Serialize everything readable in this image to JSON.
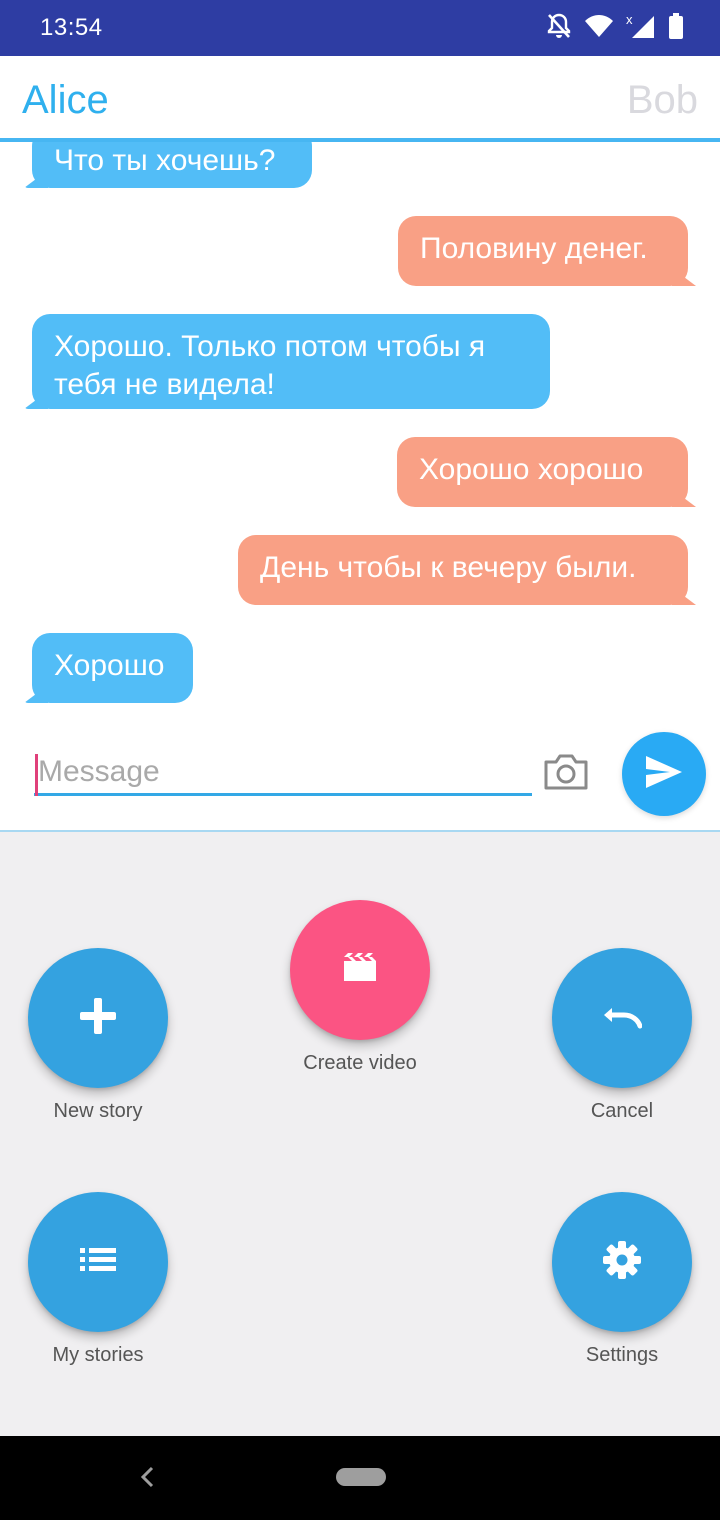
{
  "status_bar": {
    "time": "13:54",
    "icons": [
      "notifications-off-icon",
      "wifi-icon",
      "signal-icon",
      "battery-icon"
    ]
  },
  "header": {
    "left_name": "Alice",
    "right_name": "Bob"
  },
  "messages": [
    {
      "side": "left",
      "text": "Что ты хочешь?"
    },
    {
      "side": "right",
      "text": "Половину денег."
    },
    {
      "side": "left",
      "text": "Хорошо. Только потом чтобы я тебя не видела!"
    },
    {
      "side": "right",
      "text": "Хорошо хорошо"
    },
    {
      "side": "right",
      "text": "День чтобы к вечеру были."
    },
    {
      "side": "left",
      "text": "Хорошо"
    }
  ],
  "input": {
    "placeholder": "Message"
  },
  "menu": {
    "new_story": "New story",
    "create_video": "Create video",
    "cancel": "Cancel",
    "my_stories": "My stories",
    "settings": "Settings"
  },
  "colors": {
    "status_bar": "#2e3da3",
    "accent": "#2fb0ee",
    "left_bubble": "#52bdf7",
    "right_bubble": "#f9a085",
    "fab": "#34a2e0",
    "fab_pink": "#fb5483"
  }
}
